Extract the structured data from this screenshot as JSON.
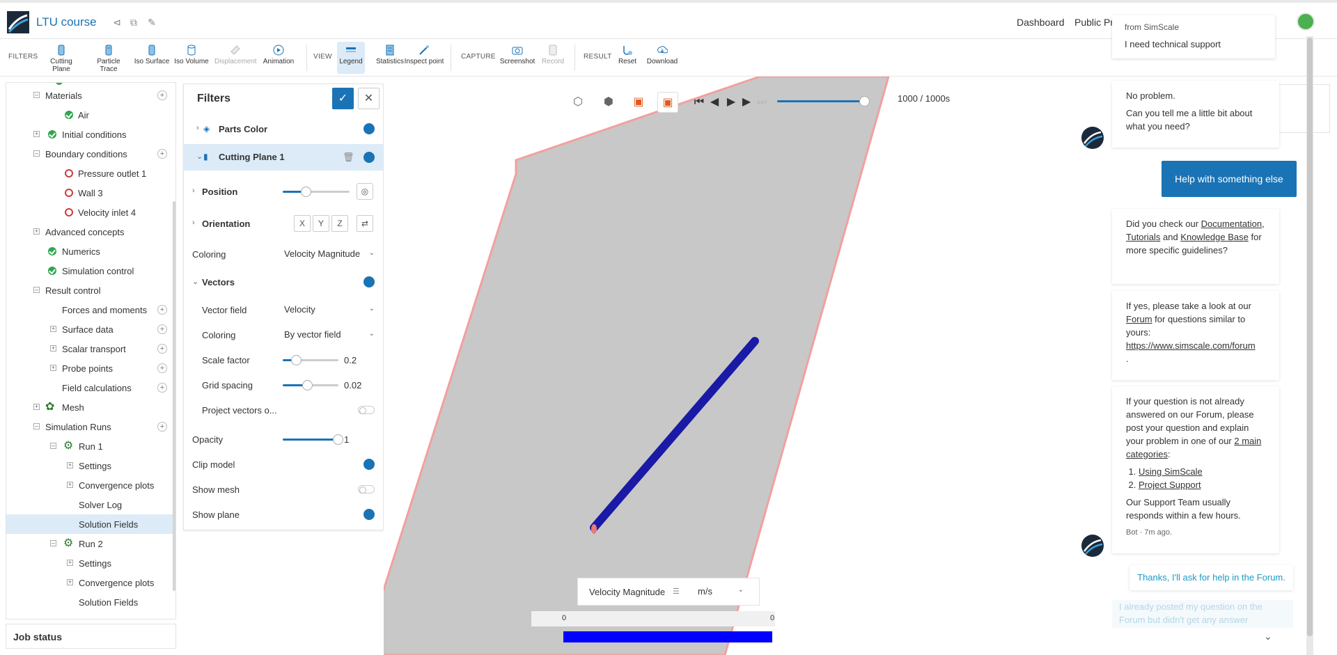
{
  "header": {
    "project_title": "LTU course",
    "nav_dashboard": "Dashboard",
    "nav_public_projects": "Public Pr"
  },
  "ribbon": {
    "filters_label": "FILTERS",
    "view_label": "VIEW",
    "capture_label": "CAPTURE",
    "result_label": "RESULT",
    "filters": [
      "Cutting Plane",
      "Particle Trace",
      "Iso Surface",
      "Iso Volume",
      "Displacement",
      "Animation"
    ],
    "view": [
      "Legend",
      "Statistics",
      "Inspect point"
    ],
    "capture": [
      "Screenshot",
      "Record"
    ],
    "result": [
      "Reset",
      "Download"
    ]
  },
  "tree": {
    "items": [
      {
        "label": "Materials"
      },
      {
        "label": "Air"
      },
      {
        "label": "Initial conditions"
      },
      {
        "label": "Boundary conditions"
      },
      {
        "label": "Pressure outlet 1"
      },
      {
        "label": "Wall 3"
      },
      {
        "label": "Velocity inlet 4"
      },
      {
        "label": "Advanced concepts"
      },
      {
        "label": "Numerics"
      },
      {
        "label": "Simulation control"
      },
      {
        "label": "Result control"
      },
      {
        "label": "Forces and moments"
      },
      {
        "label": "Surface data"
      },
      {
        "label": "Scalar transport"
      },
      {
        "label": "Probe points"
      },
      {
        "label": "Field calculations"
      },
      {
        "label": "Mesh"
      },
      {
        "label": "Simulation Runs"
      },
      {
        "label": "Run 1"
      },
      {
        "label": "Settings"
      },
      {
        "label": "Convergence plots"
      },
      {
        "label": "Solver Log"
      },
      {
        "label": "Solution Fields"
      },
      {
        "label": "Run 2"
      },
      {
        "label": "Settings"
      },
      {
        "label": "Convergence plots"
      },
      {
        "label": "Solution Fields"
      }
    ],
    "job_status": "Job status"
  },
  "filters_panel": {
    "title": "Filters",
    "parts_color": "Parts Color",
    "cutting_plane": "Cutting Plane 1",
    "position": "Position",
    "orientation": "Orientation",
    "orient_x": "X",
    "orient_y": "Y",
    "orient_z": "Z",
    "coloring_label": "Coloring",
    "coloring_value": "Velocity Magnitude",
    "vectors": "Vectors",
    "vector_field_label": "Vector field",
    "vector_field_value": "Velocity",
    "vec_coloring_label": "Coloring",
    "vec_coloring_value": "By vector field",
    "scale_factor_label": "Scale factor",
    "scale_factor_value": "0.2",
    "grid_spacing_label": "Grid spacing",
    "grid_spacing_value": "0.02",
    "project_vectors_label": "Project vectors o...",
    "opacity_label": "Opacity",
    "opacity_value": "1",
    "clip_model_label": "Clip model",
    "show_mesh_label": "Show mesh",
    "show_plane_label": "Show plane"
  },
  "viewport": {
    "time_readout": "1000 / 1000s",
    "legend_title": "Velocity Magnitude",
    "legend_unit": "m/s",
    "legend_min": "0",
    "legend_max": "0"
  },
  "chat": {
    "from": "from SimScale",
    "header_msg": "I need technical support",
    "bot1_line1": "No problem.",
    "bot1_line2": "Can you tell me a little bit about what you need?",
    "user_choice": "Help with something else",
    "bot2_pre": "Did you check our ",
    "bot2_link1": "Documentation",
    "bot2_sep": ", ",
    "bot2_link2": "Tutorials",
    "bot2_and": " and ",
    "bot2_link3": "Knowledge Base",
    "bot2_post": " for more specific guidelines?",
    "bot3_pre": "If yes, please take a look at our ",
    "bot3_link1": "Forum",
    "bot3_mid": " for questions similar to yours: ",
    "bot3_link2": "https://www.simscale.com/forum",
    "bot3_post": ".",
    "bot4_pre": "If your question is not already answered on our Forum, please post your question and explain your problem in one of our ",
    "bot4_link": "2 main categories",
    "bot4_post": ":",
    "bot4_list": [
      "Using SimScale",
      "Project Support"
    ],
    "bot4_footer": "Our Support Team usually responds within a few hours.",
    "bot4_meta": "Bot · 7m ago.",
    "user_reply": "Thanks, I'll ask for help in the Forum.",
    "user_fade": "I already posted my question on the Forum but didn't get any answer"
  },
  "colors": {
    "accent": "#1a73b5",
    "legend_bar": "#0000ff",
    "vector_blue": "#1a1aa6",
    "plane_gray": "#c8c8c8",
    "edge_red": "#f2a0a0"
  },
  "state": {
    "time_slider_fraction": 1.0,
    "position_slider_fraction": 0.35,
    "scale_factor_fraction": 0.25,
    "grid_spacing_fraction": 0.45,
    "opacity_fraction": 1.0
  }
}
